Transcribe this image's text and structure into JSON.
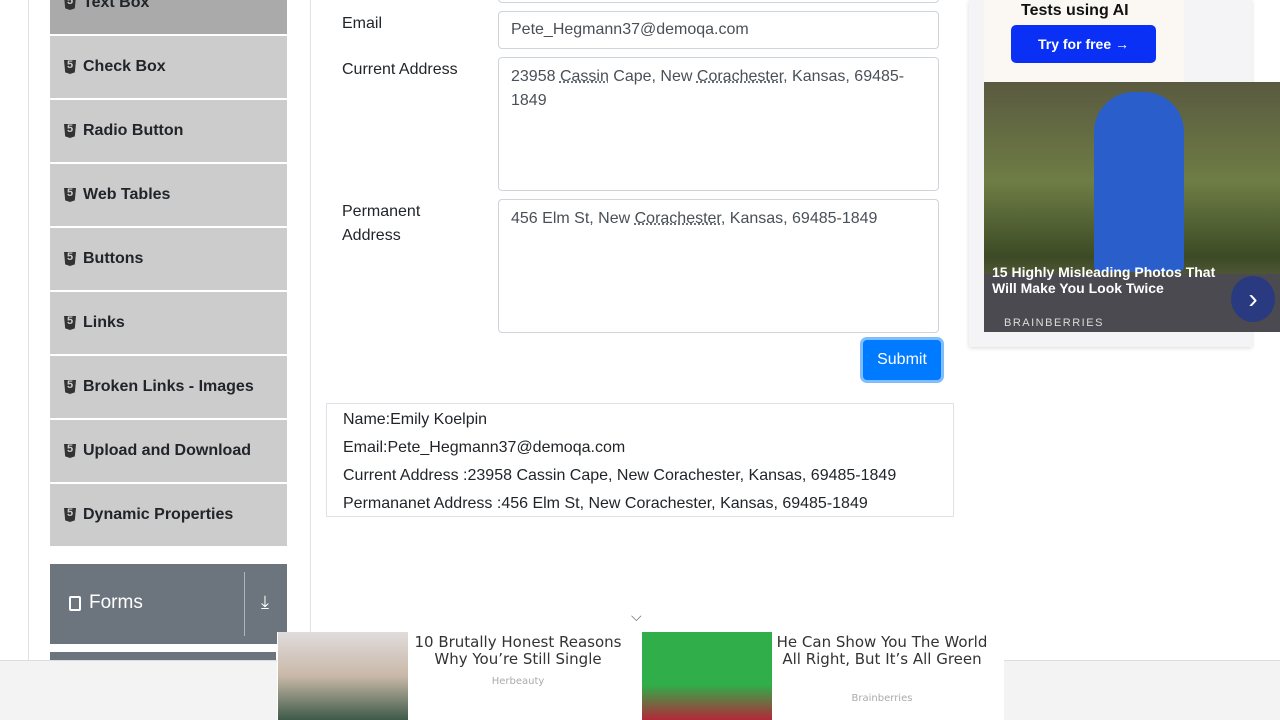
{
  "sidebar": {
    "items": [
      "Text Box",
      "Check Box",
      "Radio Button",
      "Web Tables",
      "Buttons",
      "Links",
      "Broken Links - Images",
      "Upload and Download",
      "Dynamic Properties"
    ],
    "group": "Forms"
  },
  "form": {
    "email_label": "Email",
    "email_value": "Pete_Hegmann37@demoqa.com",
    "current_label": "Current Address",
    "current_value": [
      "23958 ",
      "Cassin",
      " Cape, New ",
      "Corachester",
      ", Kansas, 69485-1849"
    ],
    "permanent_label": "Permanent Address",
    "permanent_value": [
      "456 Elm St, New ",
      "Corachester",
      ", Kansas, 69485-1849"
    ],
    "submit": "Submit"
  },
  "output": {
    "name": "Name:Emily Koelpin",
    "email": "Email:Pete_Hegmann37@demoqa.com",
    "current": "Current Address :23958 Cassin Cape, New Corachester, Kansas, 69485-1849",
    "permanent": "Permananet Address :456 Elm St, New Corachester, Kansas, 69485-1849"
  },
  "ad_right": {
    "top_text": "Tests using AI",
    "cta": "Try for free →",
    "headline": "15 Highly Misleading Photos That Will Make You Look Twice",
    "source": "BRAINBERRIES"
  },
  "ad_bottom": [
    {
      "title": "10 Brutally Honest Reasons Why You’re Still Single",
      "source": "Herbeauty"
    },
    {
      "title": "He Can Show You The World All Right, But It’s All Green",
      "source": "Brainberries"
    }
  ],
  "colors": {
    "accent": "#007bff",
    "sidebar": "#cccccc",
    "group": "#6c757d"
  }
}
